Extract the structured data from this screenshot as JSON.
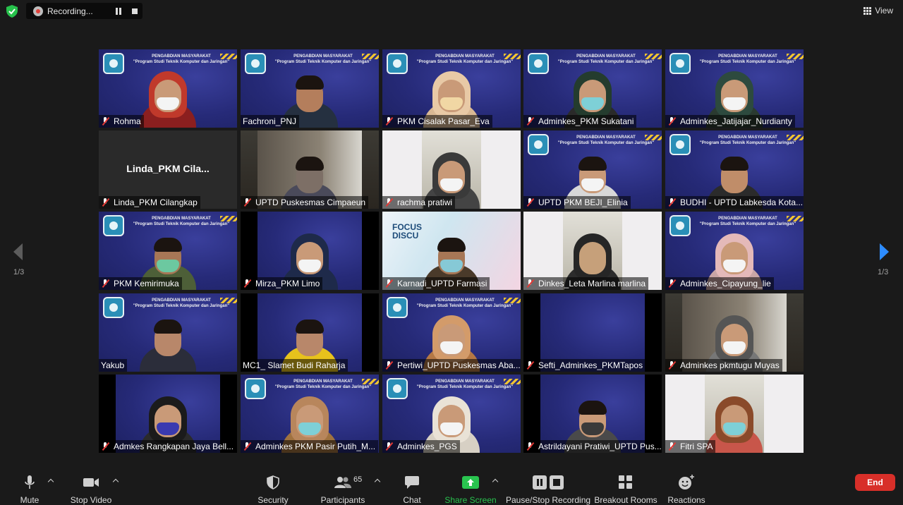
{
  "top_bar": {
    "recording_label": "Recording...",
    "view_label": "View"
  },
  "navigation": {
    "left_page": "1/3",
    "right_page": "1/3"
  },
  "slide": {
    "line1": "PENGABDIAN MASYARAKAT",
    "line2": "\"Program Studi Teknik Komputer dan Jaringan\""
  },
  "focus_slide_text": [
    "FOCUS",
    "DISCU"
  ],
  "tiles": [
    {
      "name": "Rohma",
      "muted": true
    },
    {
      "name": "Fachroni_PNJ",
      "muted": false,
      "active_speaker": true
    },
    {
      "name": "PKM Cisalak Pasar_Eva",
      "muted": true
    },
    {
      "name": "Adminkes_PKM Sukatani",
      "muted": true
    },
    {
      "name": "Adminkes_Jatijajar_Nurdianty",
      "muted": true
    },
    {
      "name": "Linda_PKM Cilangkap",
      "display_name": "Linda_PKM  Cila...",
      "muted": true
    },
    {
      "name": "UPTD Puskesmas Cimpaeun",
      "muted": true
    },
    {
      "name": "rachma pratiwi",
      "muted": true
    },
    {
      "name": "UPTD PKM BEJI_Elinia",
      "muted": true
    },
    {
      "name": "BUDHI - UPTD Labkesda Kota...",
      "muted": true
    },
    {
      "name": "PKM Kemirimuka",
      "muted": true
    },
    {
      "name": "Mirza_PKM Limo",
      "muted": true
    },
    {
      "name": "Karnadi_UPTD Farmasi",
      "muted": true
    },
    {
      "name": "Dinkes_Leta Marlina marlina",
      "muted": true
    },
    {
      "name": "Adminkes_Cipayung_lie",
      "muted": true
    },
    {
      "name": "Yakub",
      "muted": false
    },
    {
      "name": "MC1_ Slamet Budi Raharja",
      "muted": false
    },
    {
      "name": "Pertiwi_UPTD Puskesmas Aba...",
      "muted": true
    },
    {
      "name": "Sefti_Adminkes_PKMTapos",
      "muted": true
    },
    {
      "name": "Adminkes pkmtugu Muyas",
      "muted": true
    },
    {
      "name": "Admkes Rangkapan Jaya Bell...",
      "muted": true
    },
    {
      "name": "Adminkes PKM Pasir Putih_M...",
      "muted": true
    },
    {
      "name": "Adminkes_PGS",
      "muted": true
    },
    {
      "name": "Astrildayani Pratiwi_UPTD Pus...",
      "muted": true
    },
    {
      "name": "Fitri SPA",
      "muted": true
    }
  ],
  "toolbar": {
    "mute": "Mute",
    "stop_video": "Stop Video",
    "security": "Security",
    "participants": "Participants",
    "participants_count": "65",
    "chat": "Chat",
    "share_screen": "Share Screen",
    "pause_stop_recording": "Pause/Stop Recording",
    "breakout_rooms": "Breakout Rooms",
    "reactions": "Reactions",
    "end": "End"
  },
  "colors": {
    "background": "#1a1a1a",
    "active_speaker_border": "#c6e34a",
    "end_button": "#d82f29",
    "share_screen": "#29c44f",
    "muted_icon": "#e53935",
    "security_shield": "#27c24c",
    "nav_arrow_active": "#2d8cff"
  }
}
